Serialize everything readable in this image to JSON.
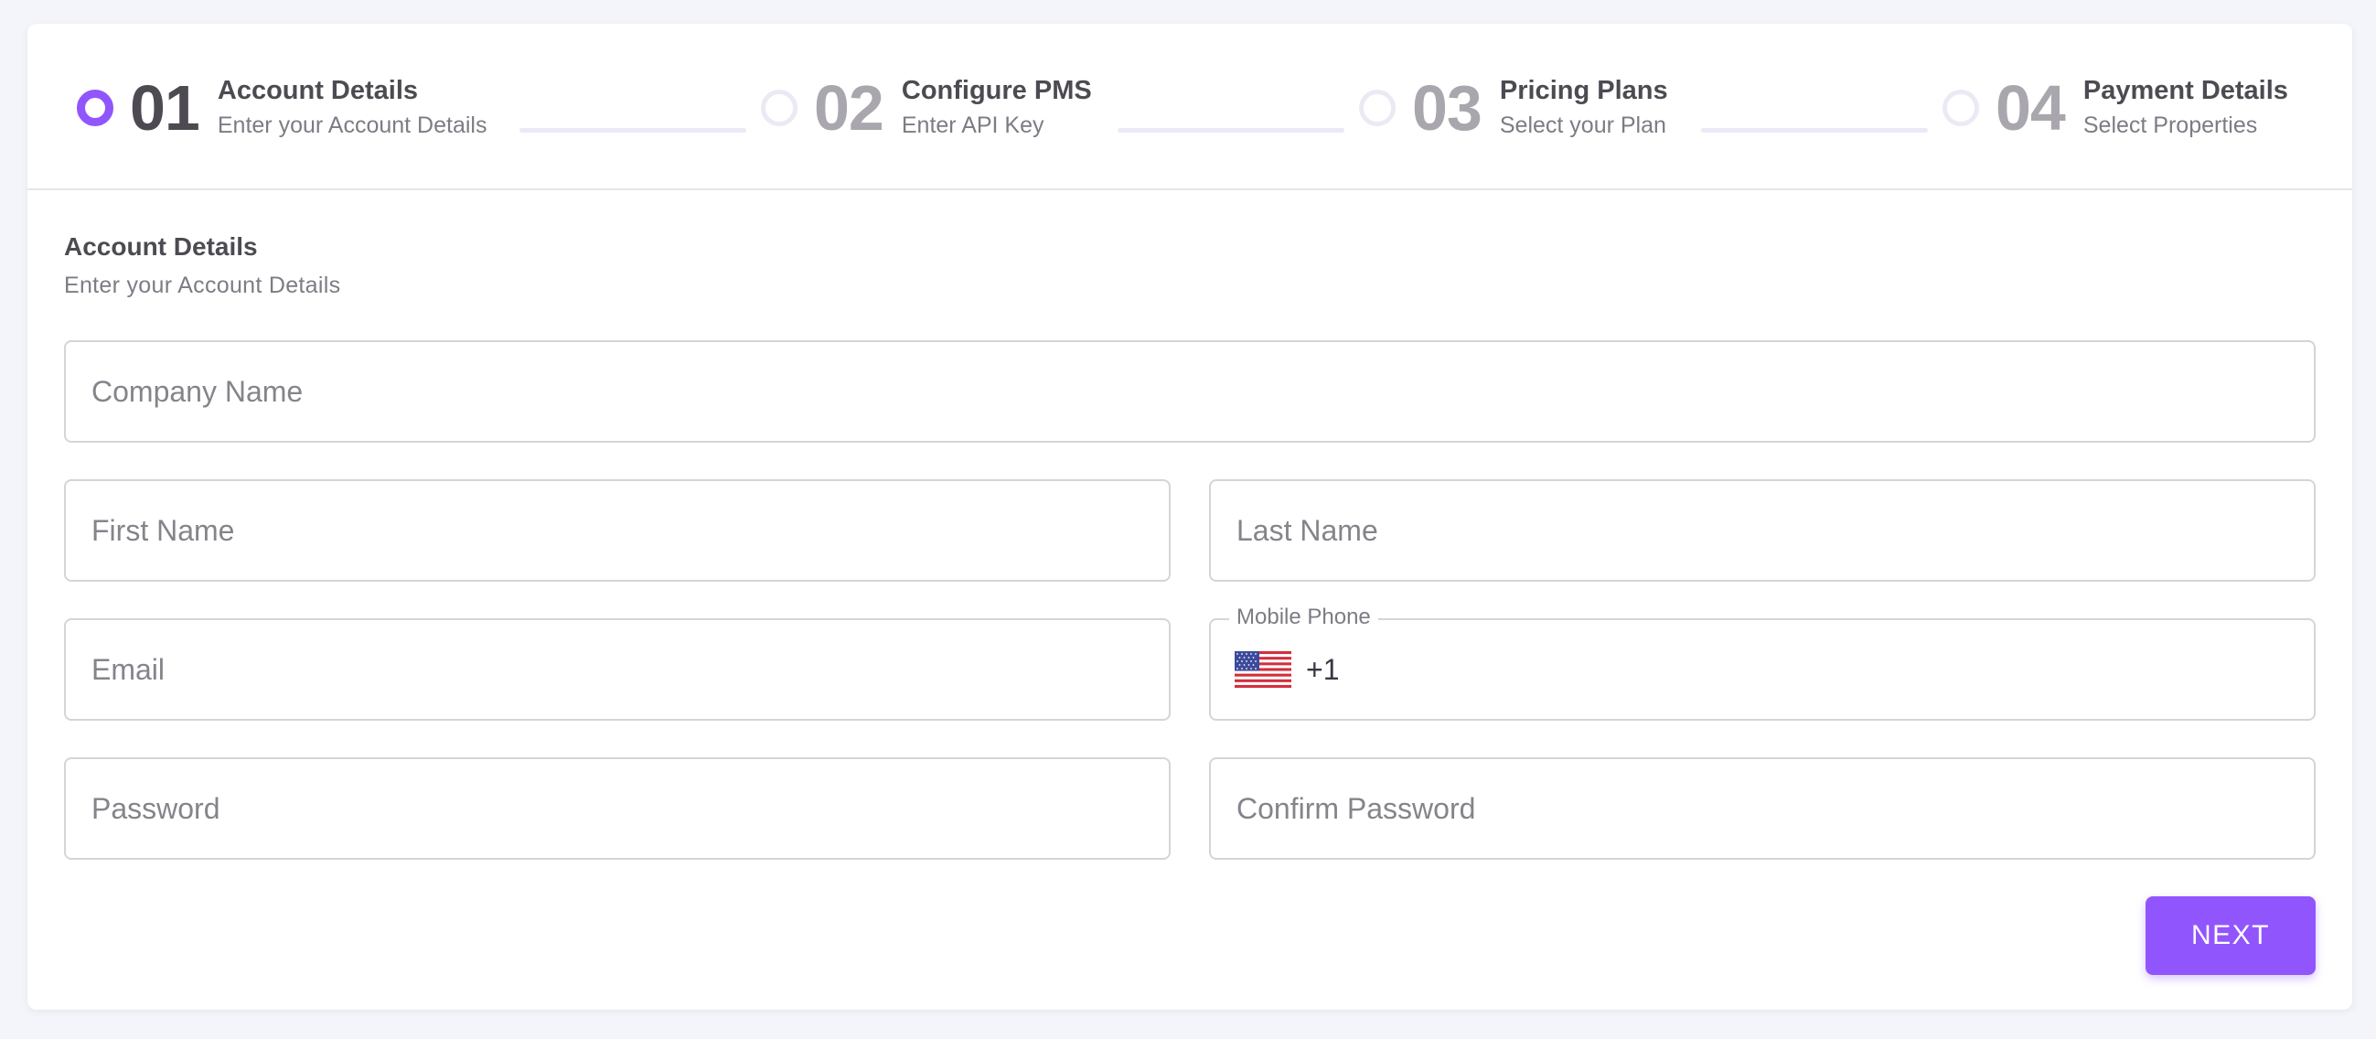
{
  "stepper": {
    "steps": [
      {
        "number": "01",
        "title": "Account Details",
        "subtitle": "Enter your Account Details"
      },
      {
        "number": "02",
        "title": "Configure PMS",
        "subtitle": "Enter API Key"
      },
      {
        "number": "03",
        "title": "Pricing Plans",
        "subtitle": "Select your Plan"
      },
      {
        "number": "04",
        "title": "Payment Details",
        "subtitle": "Select Properties"
      }
    ],
    "active_step": 1
  },
  "section": {
    "title": "Account Details",
    "subtitle": "Enter your Account Details"
  },
  "form": {
    "company_name": {
      "placeholder": "Company Name",
      "value": ""
    },
    "first_name": {
      "placeholder": "First Name",
      "value": ""
    },
    "last_name": {
      "placeholder": "Last Name",
      "value": ""
    },
    "email": {
      "placeholder": "Email",
      "value": ""
    },
    "mobile_phone": {
      "label": "Mobile Phone",
      "country_code": "+1",
      "country_flag": "us-flag-icon",
      "value": ""
    },
    "password": {
      "placeholder": "Password",
      "value": ""
    },
    "confirm_password": {
      "placeholder": "Confirm Password",
      "value": ""
    }
  },
  "actions": {
    "next_label": "NEXT"
  },
  "colors": {
    "accent": "#9155fd",
    "background": "#f4f5fa",
    "card": "#ffffff",
    "text_primary": "#4d4a52",
    "text_secondary": "#7e7b84",
    "border": "#d5d4d8"
  }
}
